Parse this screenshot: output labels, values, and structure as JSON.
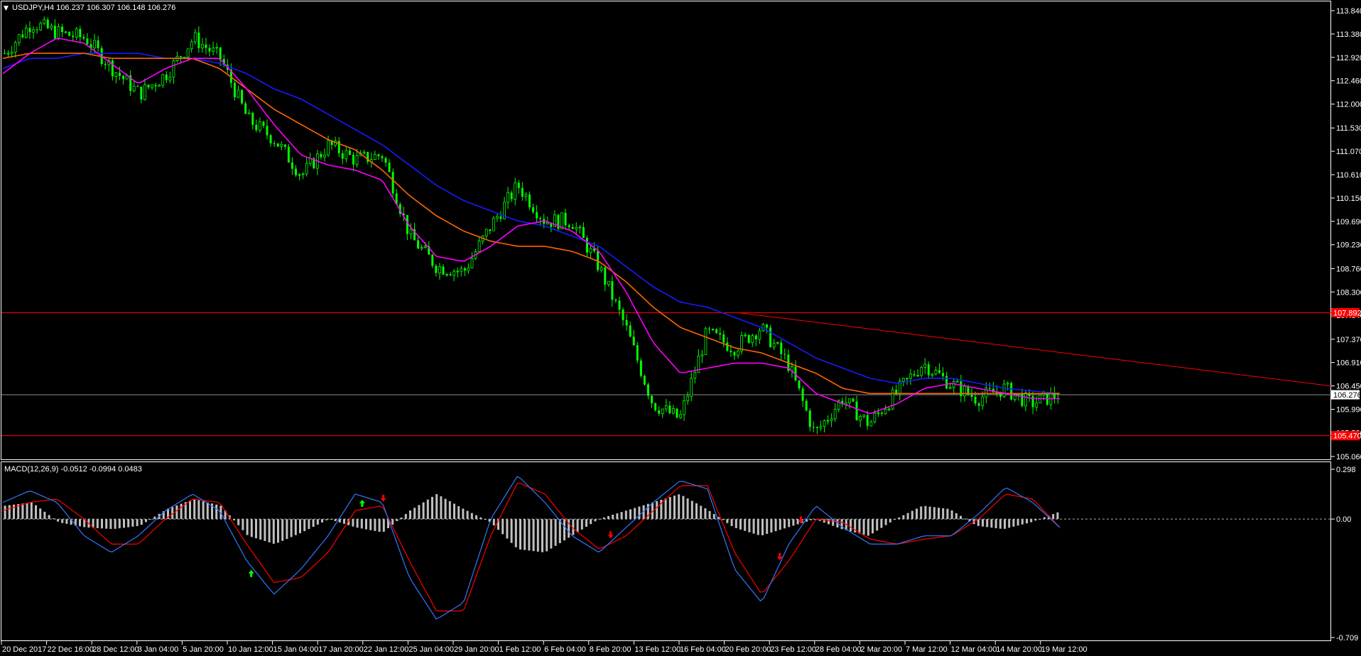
{
  "window": {
    "main_title": "USDJPY,H4  106.237 106.307 106.148 106.276",
    "indicator_title": "MACD(12,26,9) -0.0512 -0.0994 0.0483"
  },
  "colors": {
    "background": "#000000",
    "axis": "#ffffff",
    "bull_candle": "#00ff00",
    "bear_candle": "#00ff00",
    "ma_fast": "#ff00ff",
    "ma_mid": "#ff6600",
    "ma_slow": "#1a1aff",
    "hlines": "#ff0000",
    "trendline": "#ff0000",
    "current_price_line": "#8c8c8c",
    "histogram": "#c0c0c0",
    "macd_line": "#3377ff",
    "signal_line": "#ff0000",
    "arrow_up": "#00ff00",
    "arrow_down": "#ff0000"
  },
  "price_axis": {
    "ticks": [
      "113.840",
      "113.380",
      "112.920",
      "112.460",
      "112.000",
      "111.530",
      "111.070",
      "110.610",
      "110.150",
      "109.690",
      "109.230",
      "108.760",
      "108.300",
      "107.840",
      "107.370",
      "106.910",
      "106.450",
      "105.990",
      "105.530",
      "105.060"
    ],
    "min": 105.06,
    "max": 113.84,
    "current_price": "106.276",
    "hline_upper_label": "107.892",
    "hline_lower_label": "105.470",
    "hline_upper": 107.892,
    "hline_lower": 105.47
  },
  "macd_axis": {
    "ticks": [
      "0.298",
      "0.00",
      "-0.709"
    ],
    "max": 0.298,
    "min": -0.709
  },
  "time_axis": {
    "labels": [
      "20 Dec 2017",
      "22 Dec 16:00",
      "28 Dec 12:00",
      "3 Jan 04:00",
      "5 Jan 20:00",
      "10 Jan 12:00",
      "15 Jan 04:00",
      "17 Jan 20:00",
      "22 Jan 12:00",
      "25 Jan 04:00",
      "29 Jan 20:00",
      "1 Feb 12:00",
      "6 Feb 04:00",
      "8 Feb 20:00",
      "13 Feb 12:00",
      "16 Feb 04:00",
      "20 Feb 20:00",
      "23 Feb 12:00",
      "28 Feb 04:00",
      "2 Mar 20:00",
      "7 Mar 12:00",
      "12 Mar 04:00",
      "14 Mar 20:00",
      "19 Mar 12:00"
    ]
  },
  "chart_data": {
    "type": "candlestick",
    "symbol": "USDJPY",
    "timeframe": "H4",
    "ylim": [
      105.06,
      113.84
    ],
    "price_anchors": [
      113.0,
      113.6,
      113.4,
      113.3,
      112.7,
      112.2,
      112.6,
      113.3,
      112.9,
      111.7,
      111.3,
      110.6,
      111.2,
      110.9,
      111.0,
      109.4,
      108.8,
      108.7,
      109.6,
      110.4,
      109.7,
      109.7,
      108.8,
      107.6,
      106.1,
      105.8,
      107.5,
      107.2,
      107.6,
      106.9,
      105.5,
      106.2,
      105.7,
      106.3,
      106.9,
      106.5,
      106.2,
      106.4,
      106.1,
      106.28
    ],
    "ma_fast": [
      112.6,
      113.0,
      113.3,
      113.2,
      112.8,
      112.4,
      112.7,
      112.9,
      112.9,
      112.3,
      111.6,
      111.0,
      110.8,
      110.7,
      110.5,
      109.6,
      109.0,
      108.9,
      109.2,
      109.6,
      109.7,
      109.5,
      109.1,
      108.3,
      107.3,
      106.7,
      106.8,
      106.9,
      106.9,
      106.8,
      106.3,
      106.1,
      105.9,
      106.1,
      106.4,
      106.5,
      106.4,
      106.3,
      106.2,
      106.2
    ],
    "ma_mid": [
      112.9,
      113.0,
      113.0,
      113.0,
      112.9,
      112.9,
      112.9,
      112.9,
      112.7,
      112.3,
      111.9,
      111.6,
      111.3,
      111.1,
      110.7,
      110.2,
      109.8,
      109.5,
      109.3,
      109.2,
      109.2,
      109.1,
      108.9,
      108.5,
      108.0,
      107.6,
      107.4,
      107.2,
      107.1,
      106.9,
      106.7,
      106.4,
      106.3,
      106.3,
      106.3,
      106.3,
      106.3,
      106.3,
      106.3,
      106.3
    ],
    "ma_slow": [
      112.7,
      112.9,
      112.9,
      113.0,
      113.0,
      113.0,
      112.9,
      112.9,
      112.8,
      112.6,
      112.3,
      112.1,
      111.8,
      111.5,
      111.2,
      110.8,
      110.4,
      110.1,
      109.9,
      109.7,
      109.6,
      109.4,
      109.2,
      108.8,
      108.4,
      108.1,
      108.0,
      107.8,
      107.6,
      107.3,
      107.0,
      106.8,
      106.6,
      106.5,
      106.6,
      106.6,
      106.5,
      106.4,
      106.35,
      106.3
    ],
    "trendline": {
      "from": 107.89,
      "to": 106.45
    },
    "macd": {
      "ylim": [
        -0.709,
        0.298
      ],
      "histogram": [
        0.08,
        0.1,
        -0.02,
        -0.05,
        -0.06,
        -0.04,
        0.06,
        0.12,
        0.08,
        -0.1,
        -0.15,
        -0.08,
        0.0,
        -0.05,
        -0.08,
        0.05,
        0.15,
        0.06,
        -0.02,
        -0.18,
        -0.2,
        -0.1,
        0.0,
        0.05,
        0.1,
        0.15,
        0.06,
        -0.05,
        -0.1,
        -0.05,
        0.0,
        -0.06,
        -0.1,
        0.0,
        0.08,
        0.06,
        -0.04,
        -0.06,
        -0.02,
        0.04
      ],
      "macd_line": [
        0.1,
        0.17,
        0.1,
        -0.1,
        -0.2,
        -0.1,
        0.05,
        0.15,
        0.05,
        -0.25,
        -0.45,
        -0.3,
        -0.1,
        0.15,
        0.1,
        -0.35,
        -0.6,
        -0.5,
        0.0,
        0.26,
        0.1,
        -0.1,
        -0.2,
        -0.05,
        0.1,
        0.23,
        0.18,
        -0.3,
        -0.5,
        -0.15,
        0.08,
        -0.05,
        -0.15,
        -0.15,
        -0.1,
        -0.1,
        0.03,
        0.19,
        0.1,
        -0.05
      ],
      "signal_line": [
        0.05,
        0.1,
        0.12,
        0.0,
        -0.15,
        -0.15,
        0.0,
        0.12,
        0.1,
        -0.15,
        -0.38,
        -0.35,
        -0.2,
        0.05,
        0.08,
        -0.25,
        -0.55,
        -0.55,
        -0.1,
        0.22,
        0.15,
        -0.05,
        -0.18,
        -0.1,
        0.05,
        0.2,
        0.2,
        -0.2,
        -0.45,
        -0.25,
        0.0,
        -0.02,
        -0.12,
        -0.15,
        -0.12,
        -0.1,
        0.0,
        0.15,
        0.12,
        -0.05
      ]
    }
  }
}
